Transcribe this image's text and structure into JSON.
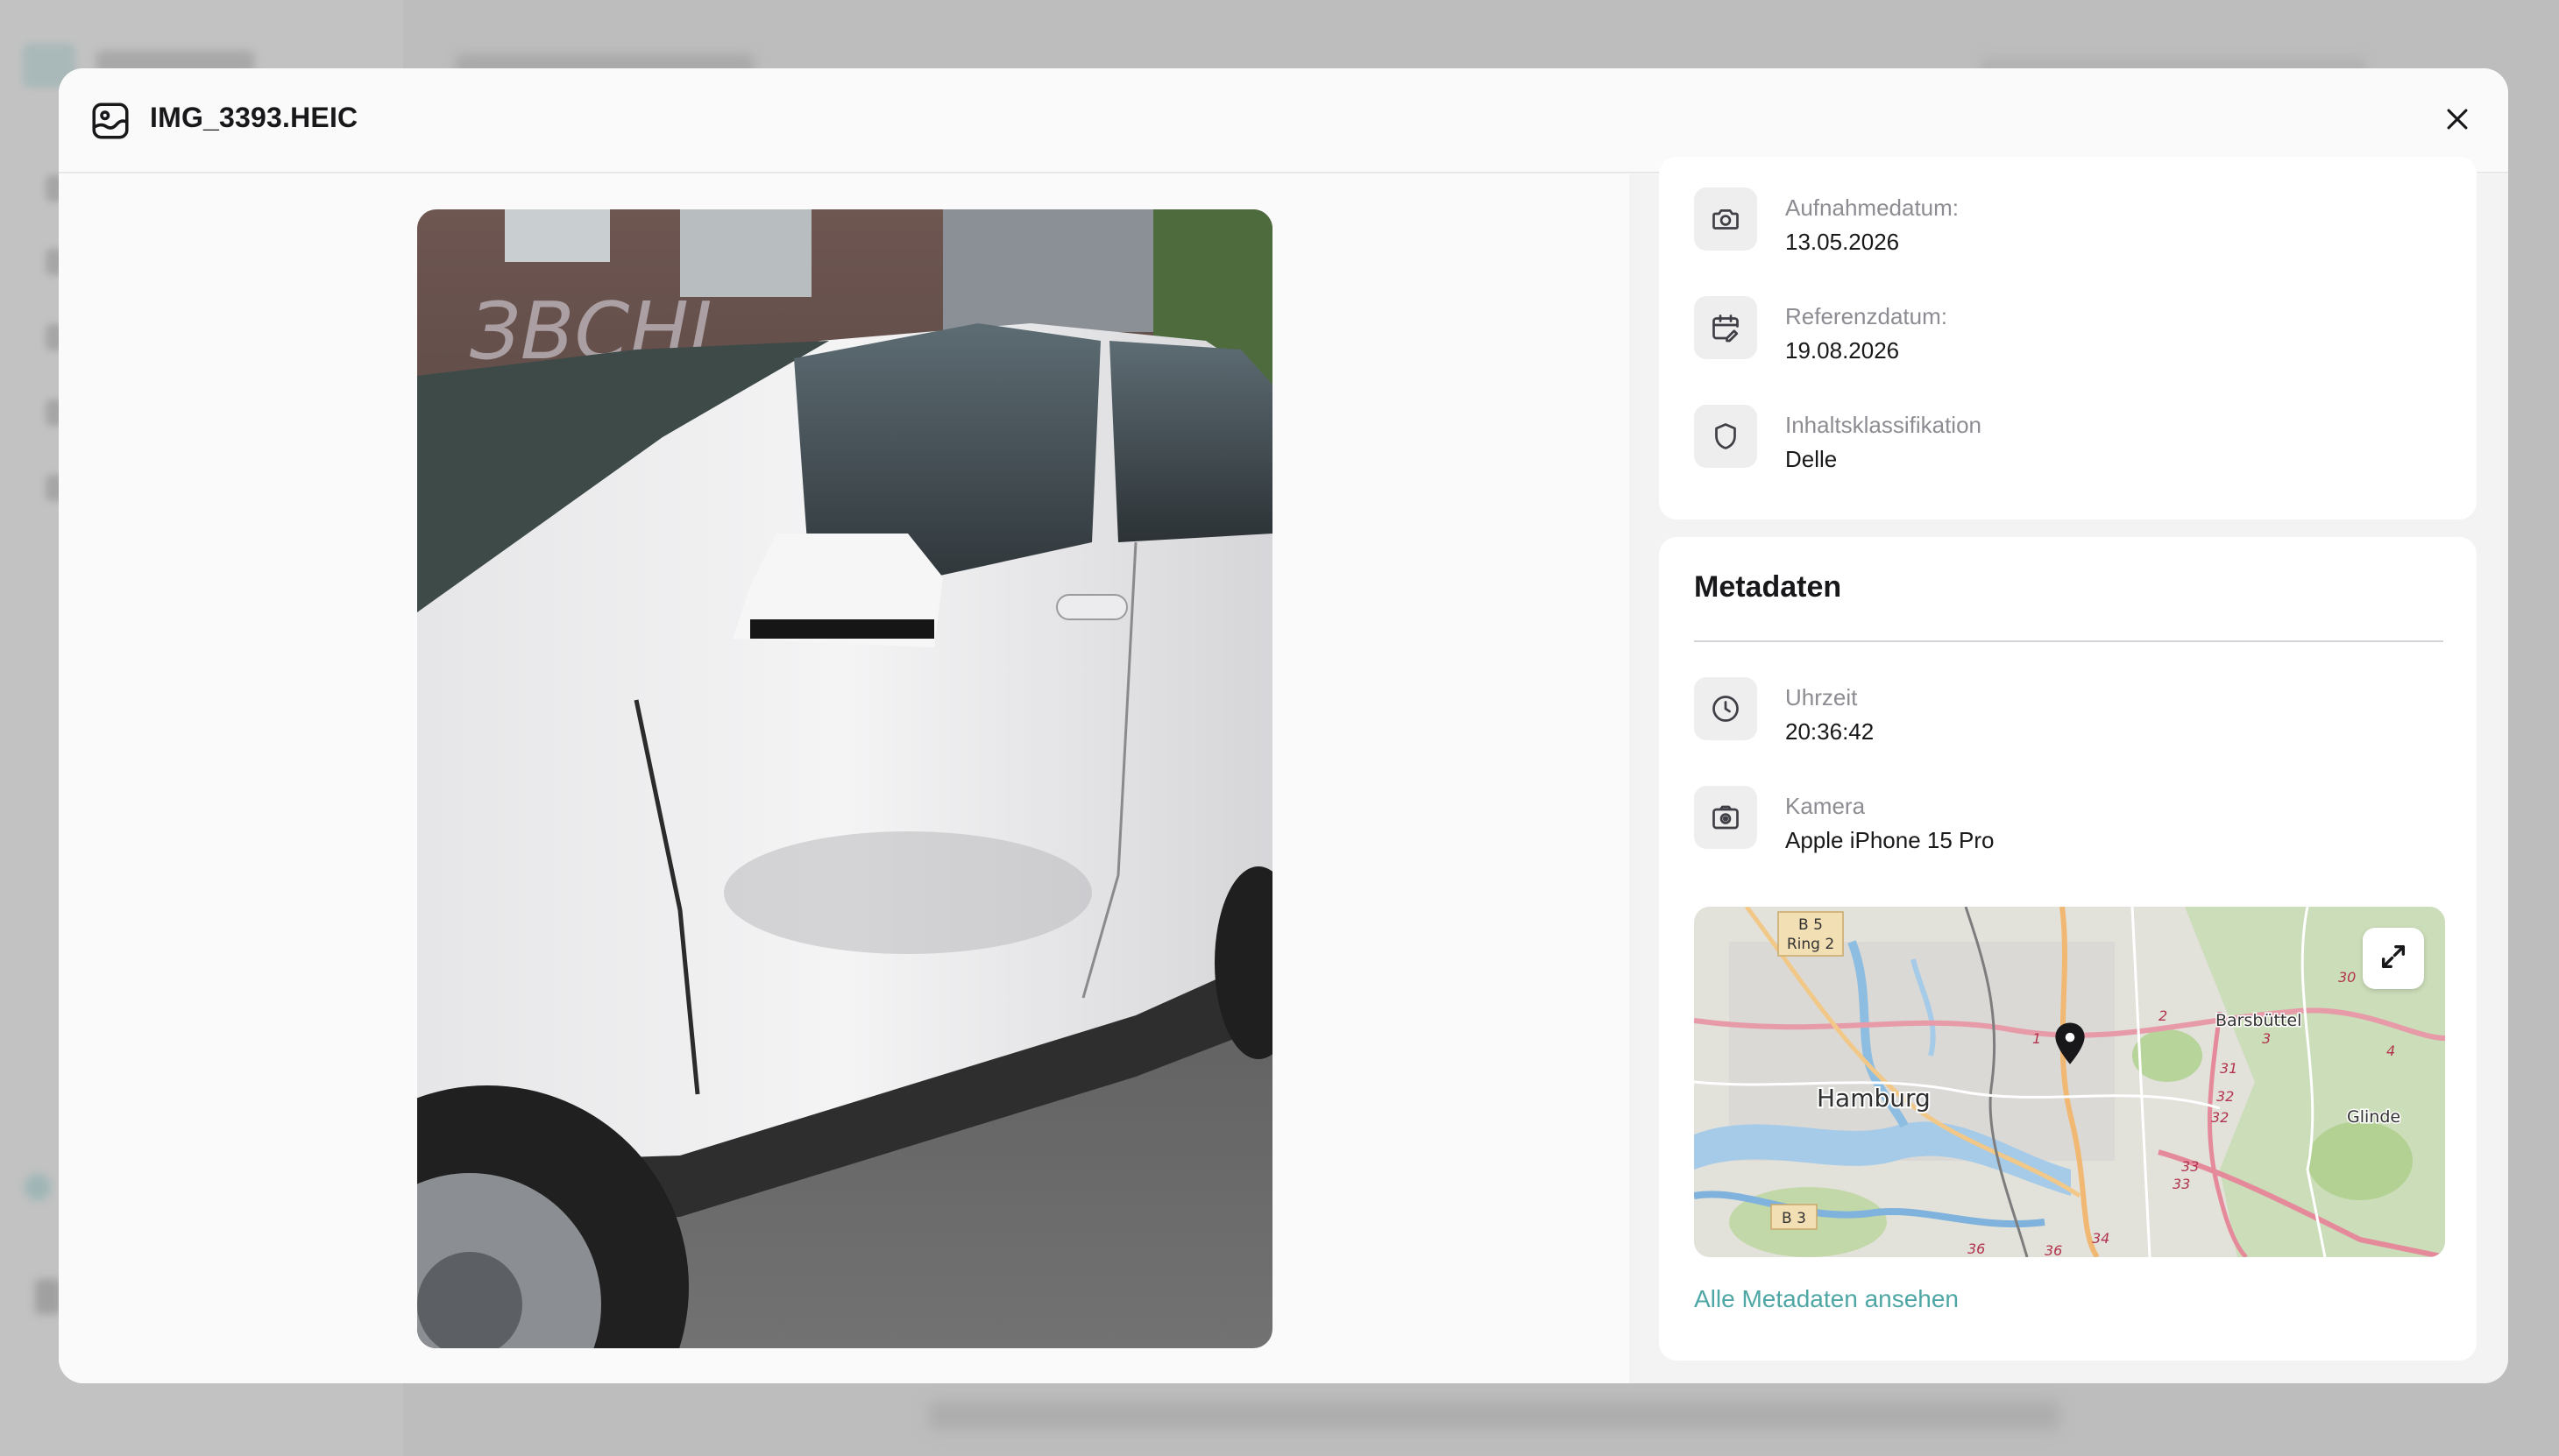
{
  "modal": {
    "title": "IMG_3393.HEIC",
    "close_icon": "close-icon",
    "header_icon": "image-icon"
  },
  "details": [
    {
      "icon": "camera-icon",
      "label": "Aufnahmedatum:",
      "value": "13.05.2026"
    },
    {
      "icon": "calendar-edit-icon",
      "label": "Referenzdatum:",
      "value": "19.08.2026"
    },
    {
      "icon": "shield-icon",
      "label": "Inhaltsklassifikation",
      "value": "Delle"
    }
  ],
  "metadata": {
    "title": "Metadaten",
    "rows": [
      {
        "icon": "clock-icon",
        "label": "Uhrzeit",
        "value": "20:36:42"
      },
      {
        "icon": "camera-icon",
        "label": "Kamera",
        "value": "Apple iPhone 15 Pro"
      }
    ],
    "map": {
      "city_label": "Hamburg",
      "labels": [
        "Barsbüttel",
        "Glinde"
      ],
      "road_shields": [
        "B 5",
        "Ring 2",
        "B 3"
      ],
      "road_numbers": [
        "30",
        "2",
        "1",
        "3",
        "4",
        "31",
        "32",
        "32",
        "33",
        "33",
        "34",
        "36",
        "36"
      ],
      "expand_icon": "expand-icon",
      "marker_icon": "map-pin-icon"
    },
    "link_label": "Alle Metadaten ansehen"
  },
  "colors": {
    "accent": "#4fa7a5",
    "text": "#18181b",
    "muted": "#8c8c92"
  }
}
